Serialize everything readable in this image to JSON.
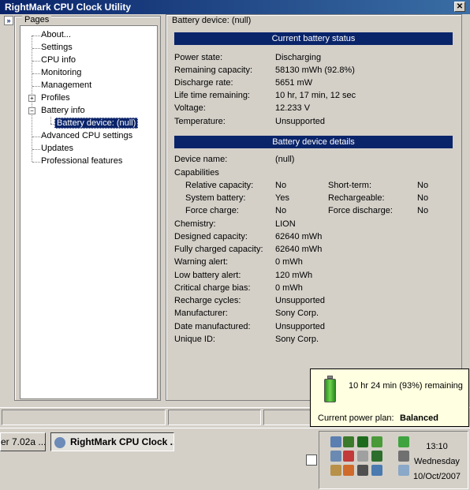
{
  "window": {
    "title": "RightMark CPU Clock Utility",
    "close_glyph": "✕"
  },
  "sidebar": {
    "group_label": "Pages",
    "expand_glyph": "»",
    "items": [
      {
        "label": "About..."
      },
      {
        "label": "Settings"
      },
      {
        "label": "CPU info"
      },
      {
        "label": "Monitoring"
      },
      {
        "label": "Management"
      },
      {
        "label": "Profiles",
        "toggle": "+"
      },
      {
        "label": "Battery info",
        "toggle": "−"
      },
      {
        "label": "Battery device: (null)"
      },
      {
        "label": "Advanced CPU settings"
      },
      {
        "label": "Updates"
      },
      {
        "label": "Professional features"
      }
    ]
  },
  "main": {
    "page_title": "Battery device: (null)",
    "status_header": "Current battery status",
    "status": [
      {
        "label": "Power state:",
        "value": "Discharging"
      },
      {
        "label": "Remaining capacity:",
        "value": "58130 mWh (92.8%)"
      },
      {
        "label": "Discharge rate:",
        "value": "5651 mW"
      },
      {
        "label": "Life time remaining:",
        "value": "10 hr, 17 min, 12 sec"
      },
      {
        "label": "Voltage:",
        "value": "12.233 V"
      },
      {
        "label": "Temperature:",
        "value": "Unsupported"
      }
    ],
    "details_header": "Battery device details",
    "device_name_label": "Device name:",
    "device_name_value": "(null)",
    "capabilities_label": "Capabilities",
    "capabilities": [
      {
        "label": "Relative capacity:",
        "value": "No",
        "label2": "Short-term:",
        "value2": "No"
      },
      {
        "label": "System battery:",
        "value": "Yes",
        "label2": "Rechargeable:",
        "value2": "No"
      },
      {
        "label": "Force charge:",
        "value": "No",
        "label2": "Force discharge:",
        "value2": "No"
      }
    ],
    "details": [
      {
        "label": "Chemistry:",
        "value": "LION"
      },
      {
        "label": "Designed capacity:",
        "value": "62640 mWh"
      },
      {
        "label": "Fully charged capacity:",
        "value": "62640 mWh"
      },
      {
        "label": "Warning alert:",
        "value": "0 mWh"
      },
      {
        "label": "Low battery alert:",
        "value": "120 mWh"
      },
      {
        "label": "Critical charge bias:",
        "value": "0 mWh"
      },
      {
        "label": "Recharge cycles:",
        "value": "Unsupported"
      },
      {
        "label": "Manufacturer:",
        "value": "Sony Corp."
      },
      {
        "label": "Date manufactured:",
        "value": "Unsupported"
      },
      {
        "label": "Unique ID:",
        "value": "Sony Corp."
      }
    ]
  },
  "popup": {
    "remaining": "10 hr 24 min (93%) remaining",
    "plan_label": "Current power plan:",
    "plan_value": "Balanced"
  },
  "taskbar": {
    "buttons": [
      {
        "label": "er 7.02a ..."
      },
      {
        "label": "RightMark CPU Clock ..."
      }
    ],
    "clock": {
      "time": "13:10",
      "day": "Wednesday",
      "date": "10/Oct/2007"
    }
  }
}
